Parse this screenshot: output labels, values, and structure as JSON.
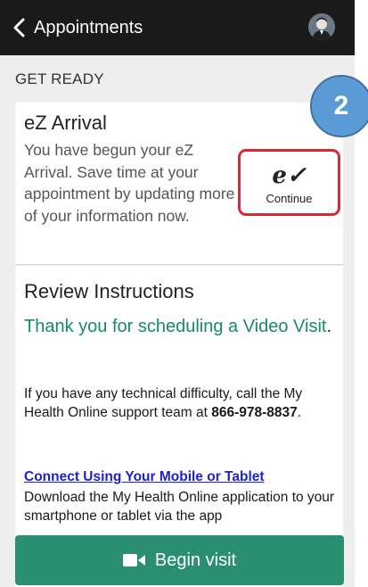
{
  "header": {
    "title": "Appointments",
    "back_icon": "chevron-left-icon",
    "avatar": "user-avatar"
  },
  "section": {
    "heading": "GET READY"
  },
  "ez_arrival": {
    "title": "eZ Arrival",
    "body": "You have begun your eZ Arrival. Save time at your appointment by updating more of your information now.",
    "continue_label": "Continue",
    "continue_icon": "e-check-icon",
    "highlight_color": "#e0262f"
  },
  "review": {
    "title": "Review Instructions",
    "thanks_text": "Thank you for scheduling a Video Visit",
    "thanks_punct": ".",
    "support_text": "If you have any technical difficulty, call the My Health Online support team at ",
    "support_phone": "866-978-8837",
    "support_end": ".",
    "connect_link": "Connect Using Your Mobile or Tablet",
    "download_text": "Download the My Health Online application to your smartphone or tablet via the app"
  },
  "begin_visit": {
    "label": "Begin visit",
    "icon": "video-camera-icon",
    "color": "#2a8f70"
  },
  "step_badge": {
    "number": "2",
    "color": "#5b9bd5"
  }
}
